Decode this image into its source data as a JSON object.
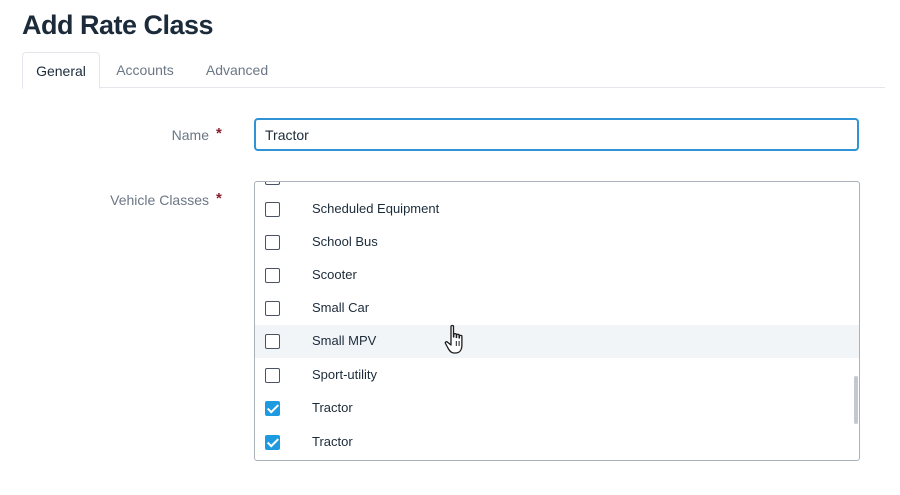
{
  "page": {
    "title": "Add Rate Class"
  },
  "tabs": [
    {
      "label": "General",
      "active": true
    },
    {
      "label": "Accounts",
      "active": false
    },
    {
      "label": "Advanced",
      "active": false
    }
  ],
  "form": {
    "name": {
      "label": "Name",
      "required_mark": "*",
      "value": "Tractor"
    },
    "vehicle_classes": {
      "label": "Vehicle Classes",
      "required_mark": "*",
      "items": [
        {
          "label": "Scheduled Equipment",
          "checked": false
        },
        {
          "label": "School Bus",
          "checked": false
        },
        {
          "label": "Scooter",
          "checked": false
        },
        {
          "label": "Small Car",
          "checked": false
        },
        {
          "label": "Small MPV",
          "checked": false,
          "hovered": true
        },
        {
          "label": "Sport-utility",
          "checked": false
        },
        {
          "label": "Tractor",
          "checked": true
        },
        {
          "label": "Tractor",
          "checked": true
        }
      ]
    }
  },
  "colors": {
    "accent": "#1e9be0",
    "focus_border": "#2f93d6",
    "required": "#8b1d2c"
  },
  "icons": {
    "cursor": "hand-pointer-icon",
    "check": "checkmark-icon"
  }
}
